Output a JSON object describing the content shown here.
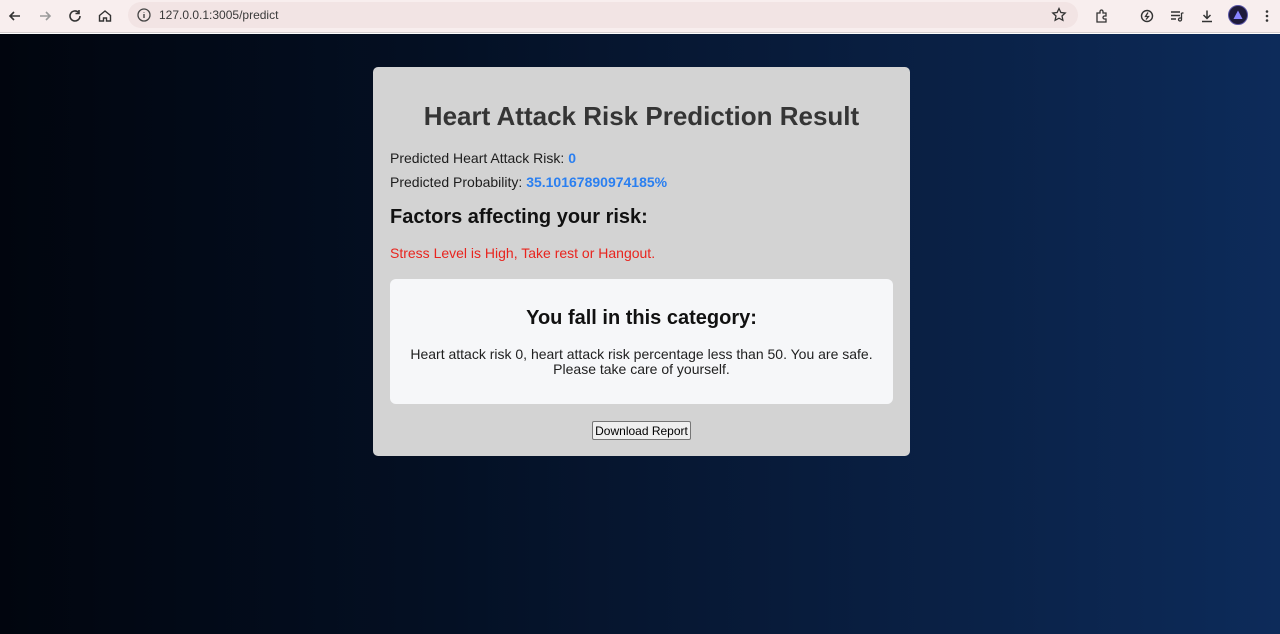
{
  "browser": {
    "url": "127.0.0.1:3005/predict",
    "icons": [
      "back-icon",
      "forward-icon",
      "reload-icon",
      "home-icon",
      "site-info-icon",
      "bookmark-star-icon",
      "extensions-icon",
      "performance-icon",
      "reading-list-icon",
      "download-icon",
      "profile-avatar",
      "more-menu-icon"
    ]
  },
  "result": {
    "title": "Heart Attack Risk Prediction Result",
    "risk_label": "Predicted Heart Attack Risk:",
    "risk_value": "0",
    "probability_label": "Predicted Probability:",
    "probability_value": "35.10167890974185%",
    "factors_heading": "Factors affecting your risk:",
    "factors": [
      "Stress Level is High, Take rest or Hangout."
    ],
    "category_heading": "You fall in this category:",
    "category_text_line1": "Heart attack risk 0, heart attack risk percentage less than 50. You are safe.",
    "category_text_line2": "Please take care of yourself.",
    "download_button": "Download Report"
  },
  "colors": {
    "value_accent": "#2a7ff0",
    "warning": "#e8241e",
    "card_bg": "#d3d3d3"
  }
}
